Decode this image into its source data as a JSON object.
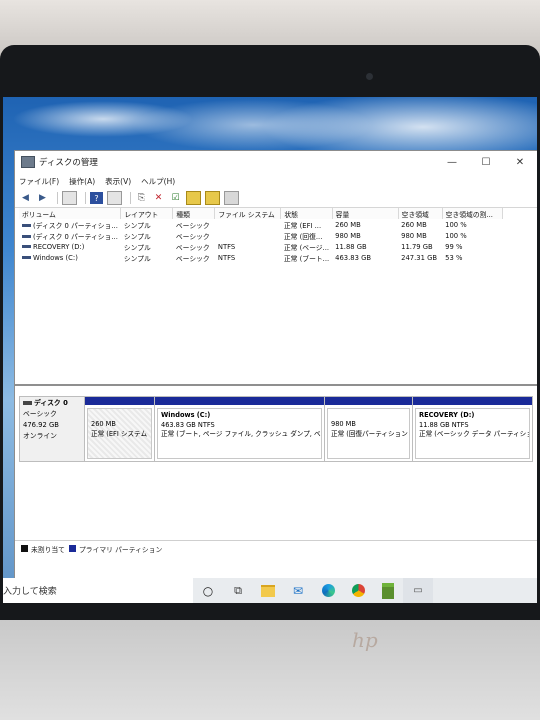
{
  "window": {
    "title": "ディスクの管理",
    "controls": {
      "minimize": "—",
      "maximize": "☐",
      "close": "✕"
    }
  },
  "menu": [
    "ファイル(F)",
    "操作(A)",
    "表示(V)",
    "ヘルプ(H)"
  ],
  "volume_table": {
    "columns": [
      "ボリューム",
      "レイアウト",
      "種類",
      "ファイル システム",
      "状態",
      "容量",
      "空き領域",
      "空き領域の割..."
    ],
    "rows": [
      [
        "(ディスク 0 パーティショ...",
        "シンプル",
        "ベーシック",
        "",
        "正常 (EFI ...",
        "260 MB",
        "260 MB",
        "100 %"
      ],
      [
        "(ディスク 0 パーティショ...",
        "シンプル",
        "ベーシック",
        "",
        "正常 (回復...",
        "980 MB",
        "980 MB",
        "100 %"
      ],
      [
        "RECOVERY (D:)",
        "シンプル",
        "ベーシック",
        "NTFS",
        "正常 (ベージ...",
        "11.88 GB",
        "11.79 GB",
        "99 %"
      ],
      [
        "Windows (C:)",
        "シンプル",
        "ベーシック",
        "NTFS",
        "正常 (ブート...",
        "463.83 GB",
        "247.31 GB",
        "53 %"
      ]
    ]
  },
  "disk": {
    "name": "ディスク 0",
    "type": "ベーシック",
    "size": "476.92 GB",
    "status": "オンライン"
  },
  "partitions": [
    {
      "title": "",
      "line1": "260 MB",
      "line2": "正常 (EFI システム"
    },
    {
      "title": "Windows (C:)",
      "line1": "463.83 GB NTFS",
      "line2": "正常 (ブート, ページ ファイル, クラッシュ ダンプ, ベー"
    },
    {
      "title": "",
      "line1": "980 MB",
      "line2": "正常 (回復パーティション"
    },
    {
      "title": "RECOVERY (D:)",
      "line1": "11.88 GB NTFS",
      "line2": "正常 (ベーシック データ パーティション"
    }
  ],
  "legend": {
    "unallocated": "未割り当て",
    "primary": "プライマリ パーティション"
  },
  "taskbar": {
    "search_placeholder": "入力して検索"
  },
  "colors": {
    "partition_bar": "#1a2a98",
    "unallocated": "#111111"
  }
}
